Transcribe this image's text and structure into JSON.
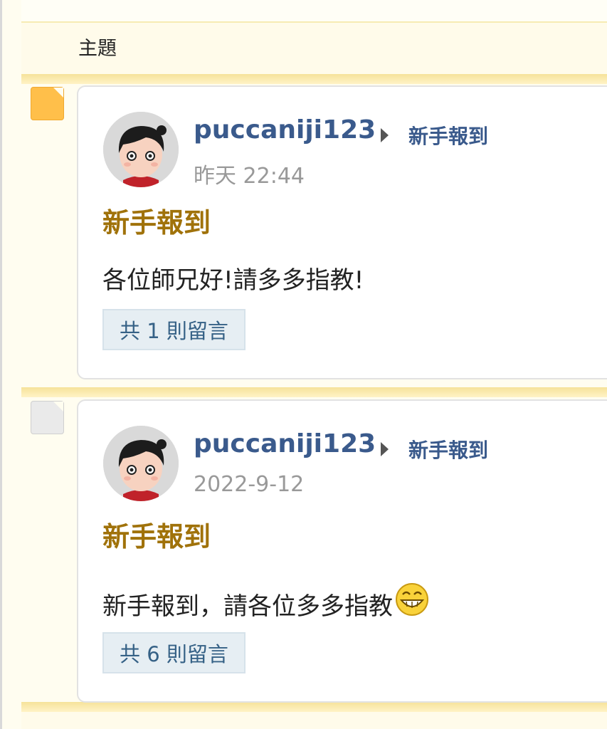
{
  "header": {
    "title": "主題"
  },
  "posts": [
    {
      "icon": "topic-new-icon",
      "author": "puccaniji123",
      "forum": "新手報到",
      "time": "昨天 22:44",
      "title": "新手報到",
      "body": "各位師兄好!請多多指教!",
      "emoji": "",
      "replies": "共 1 則留言"
    },
    {
      "icon": "topic-read-icon",
      "author": "puccaniji123",
      "forum": "新手報到",
      "time": "2022-9-12",
      "title": "新手報到",
      "body": "新手報到，請各位多多指教",
      "emoji": "grin-emoji-icon",
      "replies": "共 6 則留言"
    }
  ],
  "colors": {
    "accent_link": "#3a5a8c",
    "title_gold": "#a0720a",
    "separator": "#f6e29a",
    "new_icon": "#ffbf4a"
  }
}
